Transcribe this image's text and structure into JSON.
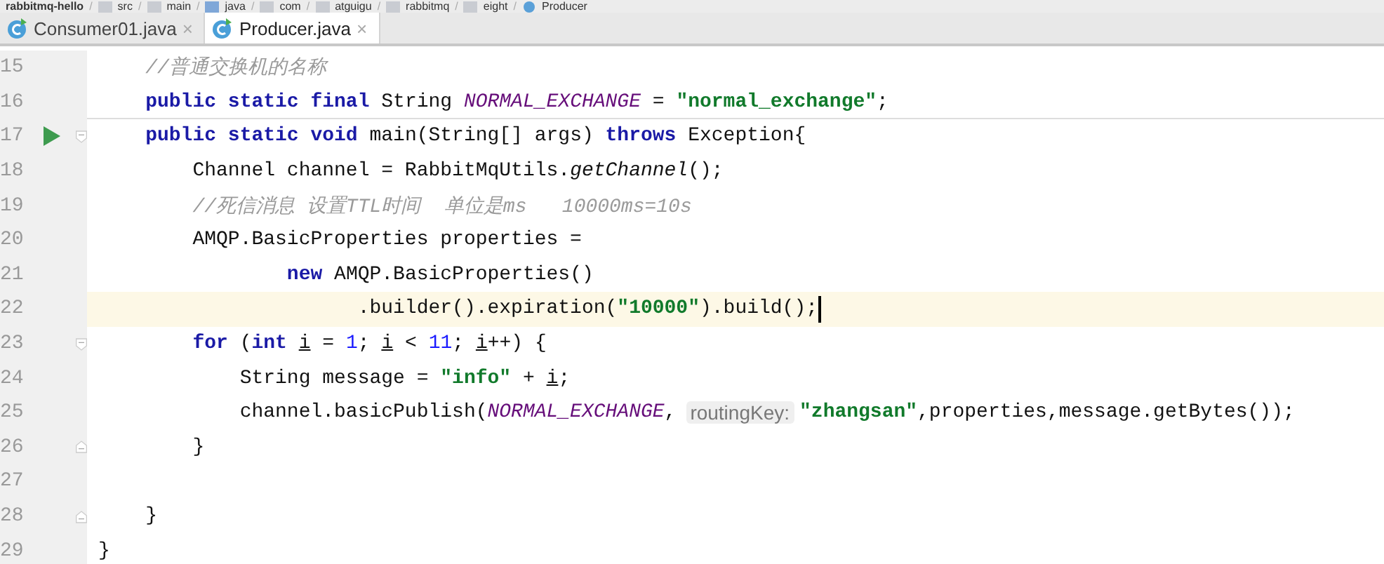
{
  "breadcrumb": [
    {
      "label": "rabbitmq-hello",
      "kind": "project",
      "sep": "/"
    },
    {
      "label": "src",
      "kind": "folder",
      "sep": "/"
    },
    {
      "label": "main",
      "kind": "folder",
      "sep": "/"
    },
    {
      "label": "java",
      "kind": "source-folder",
      "sep": "/"
    },
    {
      "label": "com",
      "kind": "folder",
      "sep": "/"
    },
    {
      "label": "atguigu",
      "kind": "folder",
      "sep": "/"
    },
    {
      "label": "rabbitmq",
      "kind": "folder",
      "sep": "/"
    },
    {
      "label": "eight",
      "kind": "folder",
      "sep": "/"
    },
    {
      "label": "Producer",
      "kind": "class"
    }
  ],
  "tabs": [
    {
      "label": "Consumer01.java",
      "close": "×",
      "selected": false
    },
    {
      "label": "Producer.java",
      "close": "×",
      "selected": true
    }
  ],
  "lines": [
    {
      "number": "15",
      "current": false,
      "separator": false,
      "runnable": false,
      "fold_start": false,
      "fold_end": false,
      "tokens": [
        {
          "t": "    //普通交换机的名称",
          "kind": "comment"
        }
      ]
    },
    {
      "number": "16",
      "current": false,
      "separator": true,
      "runnable": false,
      "fold_start": false,
      "fold_end": false,
      "tokens": [
        {
          "t": "    public static final",
          "kind": "keyword"
        },
        {
          "t": " String ",
          "kind": "plain"
        },
        {
          "t": "NORMAL_EXCHANGE",
          "kind": "field"
        },
        {
          "t": " = ",
          "kind": "plain"
        },
        {
          "t": "\"normal_exchange\"",
          "kind": "string"
        },
        {
          "t": ";",
          "kind": "plain"
        }
      ]
    },
    {
      "number": "17",
      "current": false,
      "separator": false,
      "runnable": true,
      "fold_start": true,
      "fold_end": false,
      "tokens": [
        {
          "t": "    public static void",
          "kind": "keyword"
        },
        {
          "t": " main(String[] args) ",
          "kind": "plain"
        },
        {
          "t": "throws",
          "kind": "keyword"
        },
        {
          "t": " Exception{",
          "kind": "plain"
        }
      ]
    },
    {
      "number": "18",
      "current": false,
      "separator": false,
      "runnable": false,
      "fold_start": false,
      "fold_end": false,
      "tokens": [
        {
          "t": "        Channel channel = RabbitMqUtils.",
          "kind": "plain"
        },
        {
          "t": "getChannel",
          "kind": "static-call"
        },
        {
          "t": "();",
          "kind": "plain"
        }
      ]
    },
    {
      "number": "19",
      "current": false,
      "separator": false,
      "runnable": false,
      "fold_start": false,
      "fold_end": false,
      "tokens": [
        {
          "t": "        //死信消息 设置TTL时间  单位是ms   10000ms=10s",
          "kind": "comment"
        }
      ]
    },
    {
      "number": "20",
      "current": false,
      "separator": false,
      "runnable": false,
      "fold_start": false,
      "fold_end": false,
      "tokens": [
        {
          "t": "        AMQP.BasicProperties properties =",
          "kind": "plain"
        }
      ]
    },
    {
      "number": "21",
      "current": false,
      "separator": false,
      "runnable": false,
      "fold_start": false,
      "fold_end": false,
      "tokens": [
        {
          "t": "                new",
          "kind": "keyword"
        },
        {
          "t": " AMQP.BasicProperties()",
          "kind": "plain"
        }
      ]
    },
    {
      "number": "22",
      "current": true,
      "separator": false,
      "runnable": false,
      "fold_start": false,
      "fold_end": false,
      "tokens": [
        {
          "t": "                      .builder().expiration(",
          "kind": "plain"
        },
        {
          "t": "\"10000\"",
          "kind": "string"
        },
        {
          "t": ").build();",
          "kind": "plain"
        }
      ]
    },
    {
      "number": "23",
      "current": false,
      "separator": false,
      "runnable": false,
      "fold_start": true,
      "fold_end": false,
      "tokens": [
        {
          "t": "        for",
          "kind": "keyword"
        },
        {
          "t": " (",
          "kind": "plain"
        },
        {
          "t": "int ",
          "kind": "keyword"
        },
        {
          "t": "i",
          "kind": "local"
        },
        {
          "t": " = ",
          "kind": "plain"
        },
        {
          "t": "1",
          "kind": "number"
        },
        {
          "t": "; ",
          "kind": "plain"
        },
        {
          "t": "i",
          "kind": "local"
        },
        {
          "t": " < ",
          "kind": "plain"
        },
        {
          "t": "11",
          "kind": "number"
        },
        {
          "t": "; ",
          "kind": "plain"
        },
        {
          "t": "i",
          "kind": "local"
        },
        {
          "t": "++) {",
          "kind": "plain"
        }
      ]
    },
    {
      "number": "24",
      "current": false,
      "separator": false,
      "runnable": false,
      "fold_start": false,
      "fold_end": false,
      "tokens": [
        {
          "t": "            String message = ",
          "kind": "plain"
        },
        {
          "t": "\"info\"",
          "kind": "string"
        },
        {
          "t": " + ",
          "kind": "plain"
        },
        {
          "t": "i",
          "kind": "local"
        },
        {
          "t": ";",
          "kind": "plain"
        }
      ]
    },
    {
      "number": "25",
      "current": false,
      "separator": false,
      "runnable": false,
      "fold_start": false,
      "fold_end": false,
      "tokens": [
        {
          "t": "            channel.basicPublish(",
          "kind": "plain"
        },
        {
          "t": "NORMAL_EXCHANGE",
          "kind": "field"
        },
        {
          "t": ",",
          "kind": "plain"
        },
        {
          "t": "routingKey:",
          "kind": "hint"
        },
        {
          "t": "\"zhangsan\"",
          "kind": "string"
        },
        {
          "t": ",properties,message.getBytes());",
          "kind": "plain"
        }
      ]
    },
    {
      "number": "26",
      "current": false,
      "separator": false,
      "runnable": false,
      "fold_start": false,
      "fold_end": true,
      "tokens": [
        {
          "t": "        }",
          "kind": "plain"
        }
      ]
    },
    {
      "number": "27",
      "current": false,
      "separator": false,
      "runnable": false,
      "fold_start": false,
      "fold_end": false
    },
    {
      "number": "28",
      "current": false,
      "separator": false,
      "runnable": false,
      "fold_start": false,
      "fold_end": true,
      "tokens": [
        {
          "t": "    }",
          "kind": "plain"
        }
      ]
    },
    {
      "number": "29",
      "current": false,
      "separator": false,
      "runnable": false,
      "fold_start": false,
      "fold_end": false,
      "tokens": [
        {
          "t": "}",
          "kind": "plain"
        }
      ]
    }
  ]
}
